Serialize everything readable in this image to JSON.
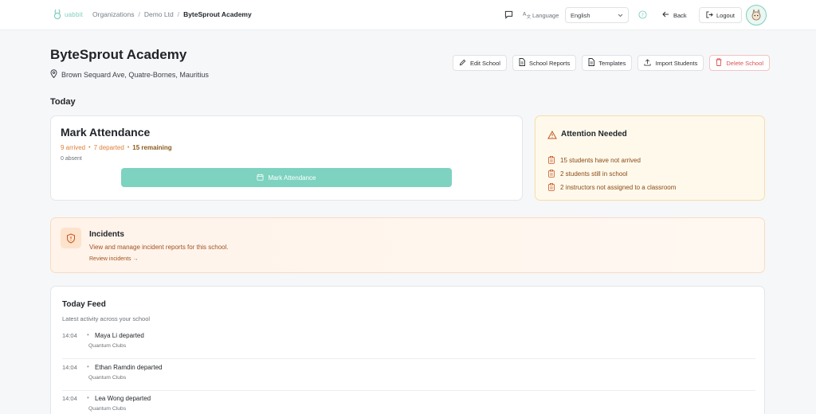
{
  "brand": {
    "logo_text": "uabbit",
    "accent_color": "#7dd3c0"
  },
  "breadcrumb": {
    "items": [
      "Organizations",
      "Demo Ltd",
      "ByteSprout Academy"
    ],
    "separator": "/"
  },
  "topbar": {
    "language_label": "Language",
    "language_value": "English",
    "back_label": "Back",
    "logout_label": "Logout"
  },
  "school": {
    "name": "ByteSprout Academy",
    "address": "Brown Sequard Ave, Quatre-Bornes, Mauritius"
  },
  "actions": {
    "edit": "Edit School",
    "reports": "School Reports",
    "templates": "Templates",
    "import": "Import Students",
    "delete": "Delete School"
  },
  "today": {
    "title": "Today",
    "attendance": {
      "title": "Mark Attendance",
      "arrived": "9 arrived",
      "departed": "7 departed",
      "remaining": "15 remaining",
      "absent": "0 absent",
      "button_label": "Mark Attendance"
    },
    "attention": {
      "title": "Attention Needed",
      "items": [
        "15 students have not arrived",
        "2 students still in school",
        "2 instructors not assigned to a classroom"
      ]
    }
  },
  "incidents": {
    "title": "Incidents",
    "description": "View and manage incident reports for this school.",
    "link": "Review incidents →"
  },
  "feed": {
    "title": "Today Feed",
    "subtitle": "Latest activity across your school",
    "items": [
      {
        "time": "14:04",
        "text": "Maya Li departed",
        "club": "Quantum Clubs"
      },
      {
        "time": "14:04",
        "text": "Ethan Ramdin departed",
        "club": "Quantum Clubs"
      },
      {
        "time": "14:04",
        "text": "Lea Wong departed",
        "club": "Quantum Clubs"
      }
    ]
  }
}
